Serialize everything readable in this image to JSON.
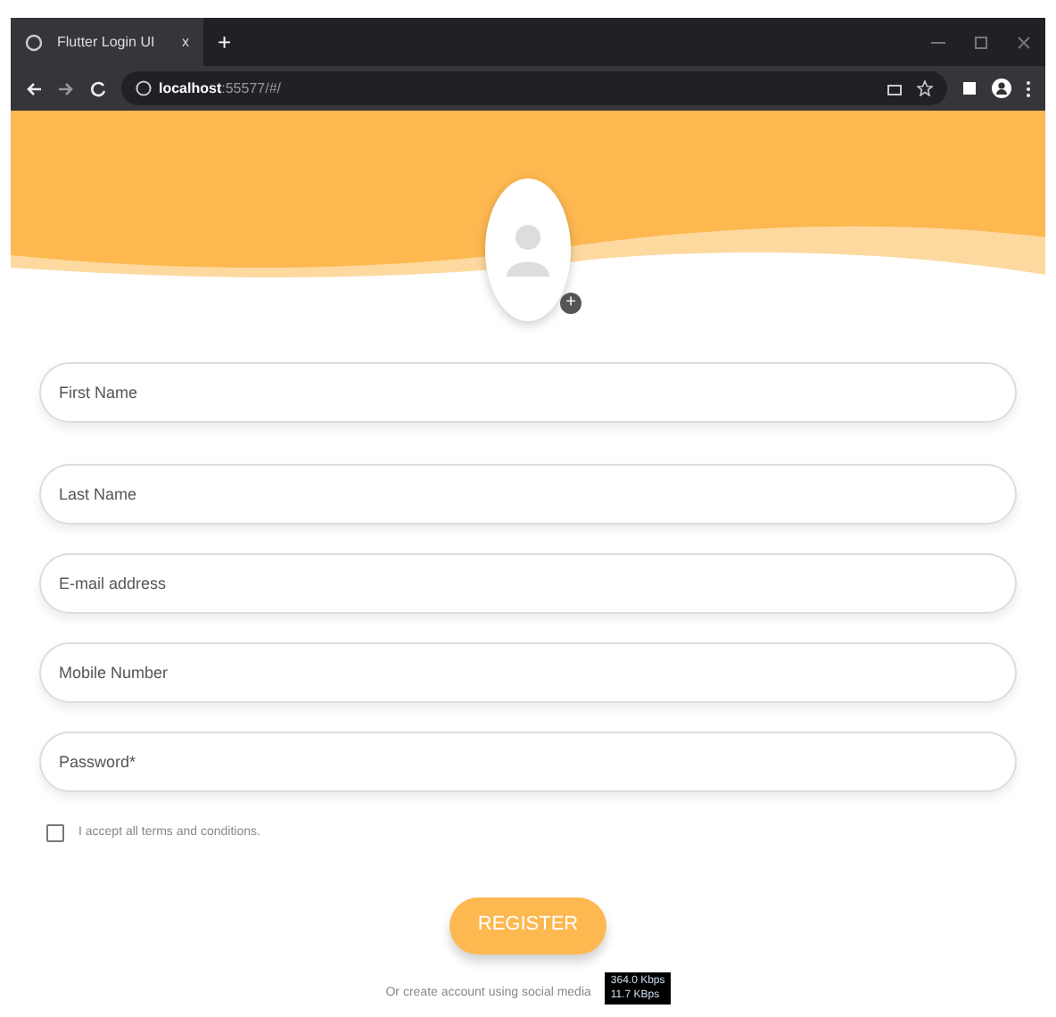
{
  "browser": {
    "tab_title": "Flutter Login UI",
    "tab_close": "x",
    "new_tab": "+",
    "url_host": "localhost",
    "url_rest": ":55577/#/"
  },
  "avatar": {
    "add_badge": "+"
  },
  "fields": [
    {
      "placeholder": "First Name"
    },
    {
      "placeholder": "Last Name"
    },
    {
      "placeholder": "E-mail address"
    },
    {
      "placeholder": "Mobile Number"
    },
    {
      "placeholder": "Password*"
    }
  ],
  "terms": {
    "label": "I accept all terms and conditions.",
    "checked": false
  },
  "register_button": "REGISTER",
  "social_text": "Or create account using social media",
  "speed_overlay": [
    "364.0 Kbps",
    "11.7 KBps"
  ]
}
